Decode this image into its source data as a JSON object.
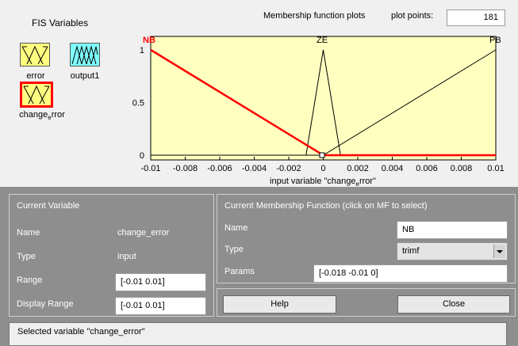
{
  "fis_variables": {
    "title": "FIS Variables",
    "inputs": [
      {
        "label": "error"
      },
      {
        "label": "change",
        "sub": "e",
        "rest": "rror"
      }
    ],
    "outputs": [
      {
        "label": "output1"
      }
    ]
  },
  "mf_plot": {
    "title": "Membership function plots",
    "plot_points_label": "plot points:",
    "plot_points_value": "181",
    "xlabel_pre": "input variable \"change",
    "xlabel_sub": "e",
    "xlabel_post": "rror\"",
    "x_ticks": [
      "-0.01",
      "-0.008",
      "-0.006",
      "-0.004",
      "-0.002",
      "0",
      "0.002",
      "0.004",
      "0.006",
      "0.008",
      "0.01"
    ],
    "y_ticks": [
      "0",
      "0.5",
      "1"
    ],
    "mf_labels": {
      "nb": "NB",
      "ze": "ZE",
      "pb": "PB"
    },
    "colors": {
      "plot_bg": "#ffffc0",
      "selected": "#ff0000",
      "normal": "#000000"
    }
  },
  "chart_data": {
    "type": "line",
    "title": "",
    "xlabel": "input variable \"change_error\"",
    "ylabel": "",
    "xlim": [
      -0.01,
      0.01
    ],
    "ylim": [
      0,
      1
    ],
    "series": [
      {
        "name": "NB",
        "x": [
          -0.018,
          -0.01,
          0,
          0.01
        ],
        "y": [
          0,
          1,
          0,
          0
        ],
        "selected": true
      },
      {
        "name": "ZE",
        "x": [
          -0.01,
          -0.001,
          0,
          0.001,
          0.01
        ],
        "y": [
          0,
          0,
          1,
          0,
          0
        ]
      },
      {
        "name": "PB",
        "x": [
          -0.01,
          0,
          0.01
        ],
        "y": [
          0,
          0,
          1
        ]
      }
    ]
  },
  "current_variable": {
    "title": "Current Variable",
    "name_label": "Name",
    "name_value": "change_error",
    "type_label": "Type",
    "type_value": "input",
    "range_label": "Range",
    "range_value": "[-0.01 0.01]",
    "display_range_label": "Display Range",
    "display_range_value": "[-0.01 0.01]"
  },
  "current_mf": {
    "title": "Current Membership Function (click on MF to select)",
    "name_label": "Name",
    "name_value": "NB",
    "type_label": "Type",
    "type_value": "trimf",
    "params_label": "Params",
    "params_value": "[-0.018 -0.01 0]"
  },
  "buttons": {
    "help": "Help",
    "close": "Close"
  },
  "status": "Selected variable \"change_error\""
}
